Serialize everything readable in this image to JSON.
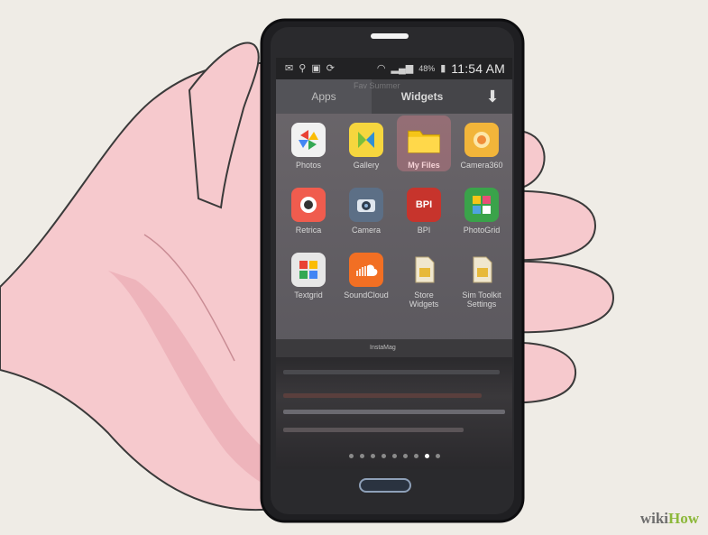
{
  "status_bar": {
    "left_icons": [
      "mail-icon",
      "usb-icon",
      "image-icon",
      "sync-icon"
    ],
    "right_icons": [
      "wifi-icon",
      "signal-icon",
      "battery-icon"
    ],
    "battery": "48%",
    "time": "11:54 AM"
  },
  "tabs": {
    "apps": "Apps",
    "widgets": "Widgets",
    "download_icon": "download-icon",
    "watermark": "Fav Summer"
  },
  "apps": [
    {
      "label": "Photos",
      "icon": "photos-icon"
    },
    {
      "label": "Gallery",
      "icon": "gallery-icon"
    },
    {
      "label": "My Files",
      "icon": "folder-icon",
      "highlighted": true
    },
    {
      "label": "Camera360",
      "icon": "camera360-icon"
    },
    {
      "label": "Retrica",
      "icon": "retrica-icon"
    },
    {
      "label": "Camera",
      "icon": "camera-icon"
    },
    {
      "label": "BPI",
      "icon": "bpi-icon"
    },
    {
      "label": "PhotoGrid",
      "icon": "photogrid-icon"
    },
    {
      "label": "Textgrid",
      "icon": "textgrid-icon"
    },
    {
      "label": "SoundCloud",
      "icon": "soundcloud-icon"
    },
    {
      "label": "Store\nWidgets",
      "icon": "sim-card-icon"
    },
    {
      "label": "Sim Toolkit\nSettings",
      "icon": "sim-toolkit-icon"
    }
  ],
  "folder_label": "InstaMag",
  "page_dots": {
    "count": 9,
    "active_index": 7
  },
  "watermark": {
    "wiki": "wiki",
    "how": "How"
  },
  "colors": {
    "skin": "#f6c9cd",
    "skin_shadow": "#e8a3ad",
    "phone_body": "#1f1f22",
    "folder_yellow": "#f5c518",
    "wikihow_green": "#8cb83a"
  }
}
